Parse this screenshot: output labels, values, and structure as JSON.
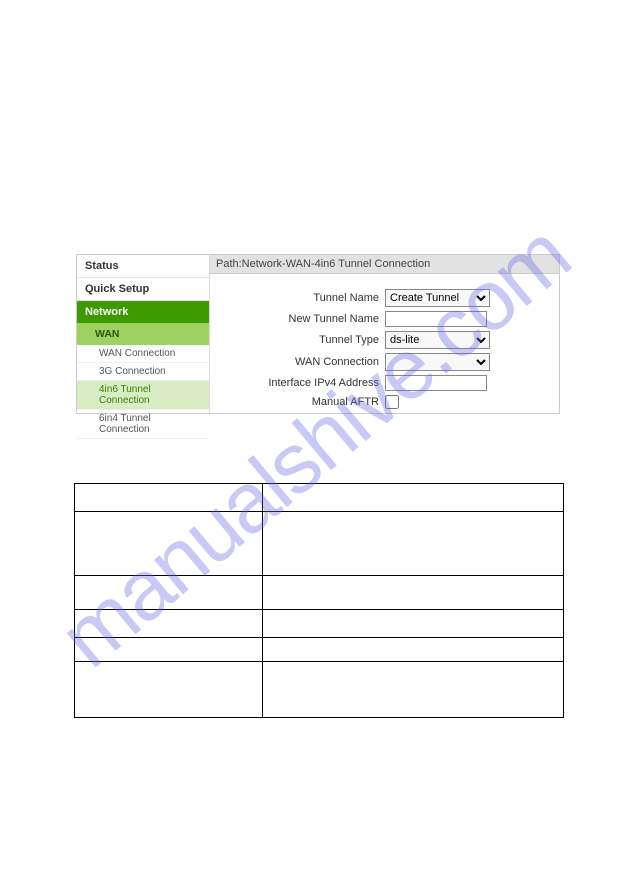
{
  "watermark": "manualshive.com",
  "sidebar": {
    "status": "Status",
    "quicksetup": "Quick Setup",
    "network": "Network",
    "wan": "WAN",
    "items": [
      "WAN Connection",
      "3G Connection",
      "4in6 Tunnel Connection",
      "6in4 Tunnel Connection"
    ]
  },
  "path": "Path:Network-WAN-4in6 Tunnel Connection",
  "form": {
    "tunnel_name_label": "Tunnel Name",
    "tunnel_name_value": "Create Tunnel",
    "new_tunnel_name_label": "New Tunnel Name",
    "tunnel_type_label": "Tunnel Type",
    "tunnel_type_value": "ds-lite",
    "wan_connection_label": "WAN Connection",
    "interface_ipv4_label": "Interface IPv4 Address",
    "manual_aftr_label": "Manual AFTR"
  }
}
